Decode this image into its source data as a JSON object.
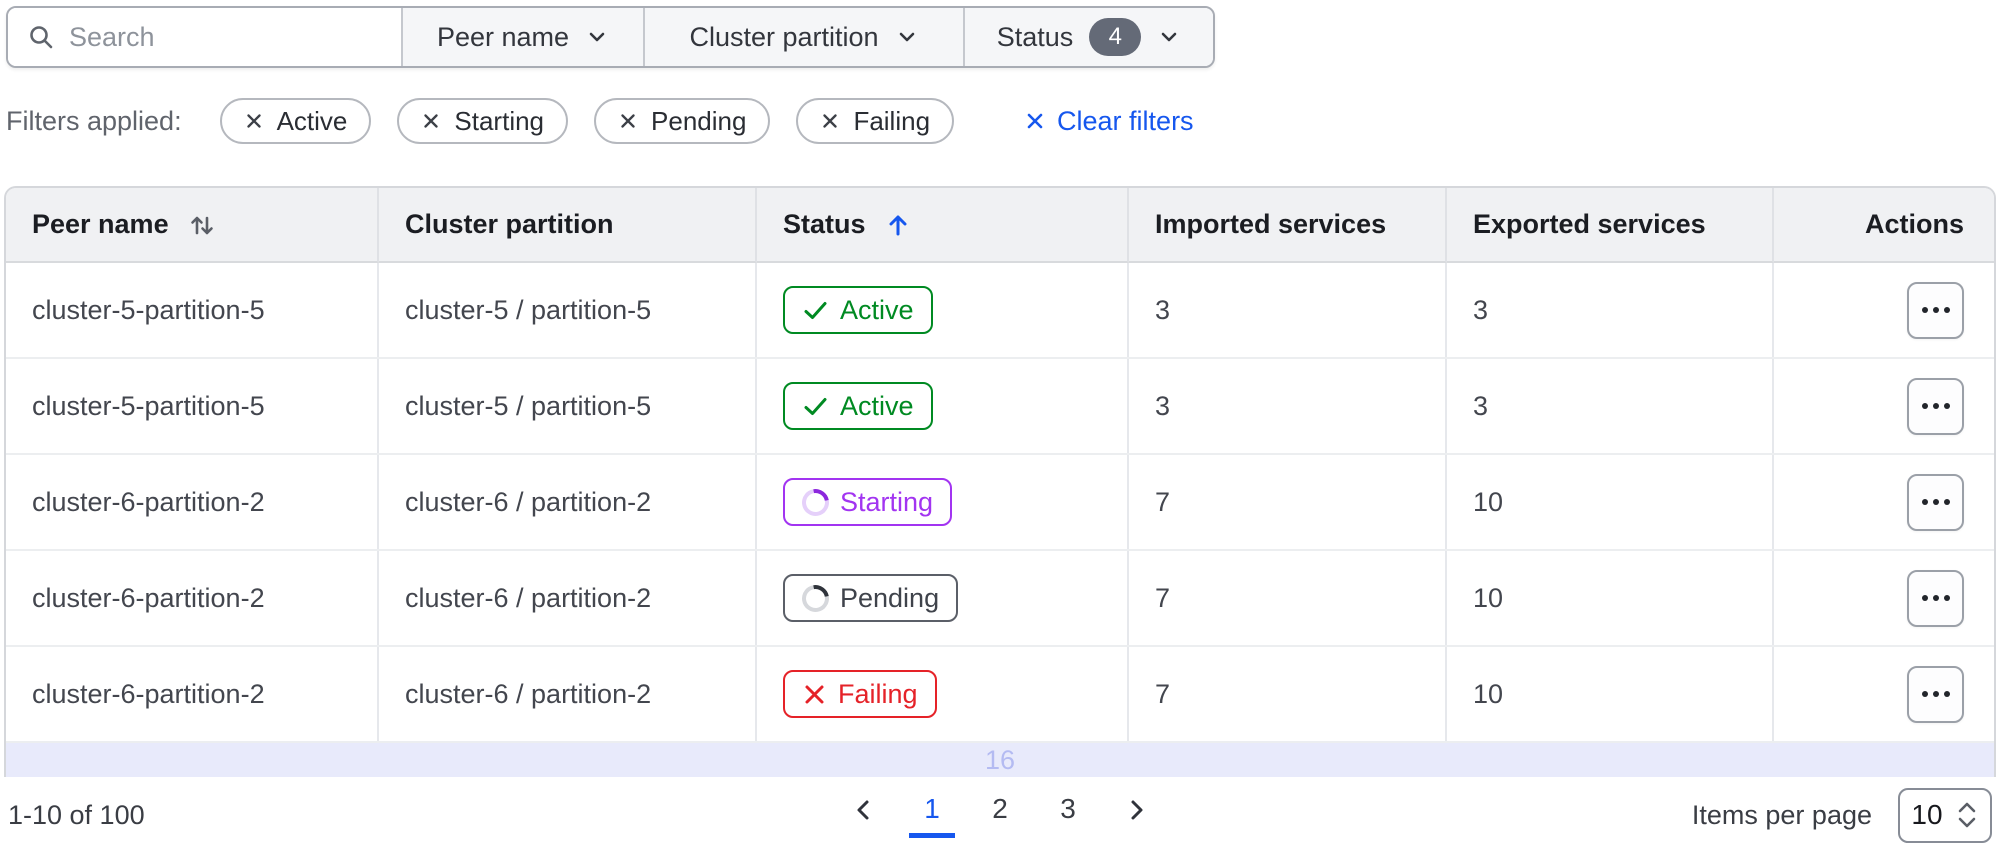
{
  "toolbar": {
    "search": {
      "placeholder": "Search"
    },
    "filter_buttons": [
      {
        "label": "Peer name"
      },
      {
        "label": "Cluster partition"
      },
      {
        "label": "Status",
        "count": "4"
      }
    ]
  },
  "filters_applied": {
    "label": "Filters applied:",
    "pills": [
      "Active",
      "Starting",
      "Pending",
      "Failing"
    ],
    "clear_label": "Clear filters"
  },
  "table": {
    "columns": [
      "Peer name",
      "Cluster partition",
      "Status",
      "Imported services",
      "Exported services",
      "Actions"
    ],
    "sort": {
      "sorted_column": "Status",
      "direction": "ascending"
    },
    "rows": [
      {
        "peer_name": "cluster-5-partition-5",
        "cluster_partition": "cluster-5 / partition-5",
        "status": "Active",
        "imported": "3",
        "exported": "3"
      },
      {
        "peer_name": "cluster-5-partition-5",
        "cluster_partition": "cluster-5 / partition-5",
        "status": "Active",
        "imported": "3",
        "exported": "3"
      },
      {
        "peer_name": "cluster-6-partition-2",
        "cluster_partition": "cluster-6 / partition-2",
        "status": "Starting",
        "imported": "7",
        "exported": "10"
      },
      {
        "peer_name": "cluster-6-partition-2",
        "cluster_partition": "cluster-6 / partition-2",
        "status": "Pending",
        "imported": "7",
        "exported": "10"
      },
      {
        "peer_name": "cluster-6-partition-2",
        "cluster_partition": "cluster-6 / partition-2",
        "status": "Failing",
        "imported": "7",
        "exported": "10"
      }
    ],
    "partial_row_text": "16"
  },
  "pagination": {
    "range": "1-10 of 100",
    "pages": [
      "1",
      "2",
      "3"
    ],
    "current_page": "1",
    "items_per_page_label": "Items per page",
    "items_per_page_value": "10"
  },
  "colors": {
    "accent_blue": "#1657ee",
    "active_green": "#008a22",
    "starting_purple": "#a234f1",
    "pending_gray": "#3f434b",
    "failing_red": "#e52228",
    "count_badge_bg": "#646a77",
    "partial_row_bg": "#e8eafb"
  }
}
